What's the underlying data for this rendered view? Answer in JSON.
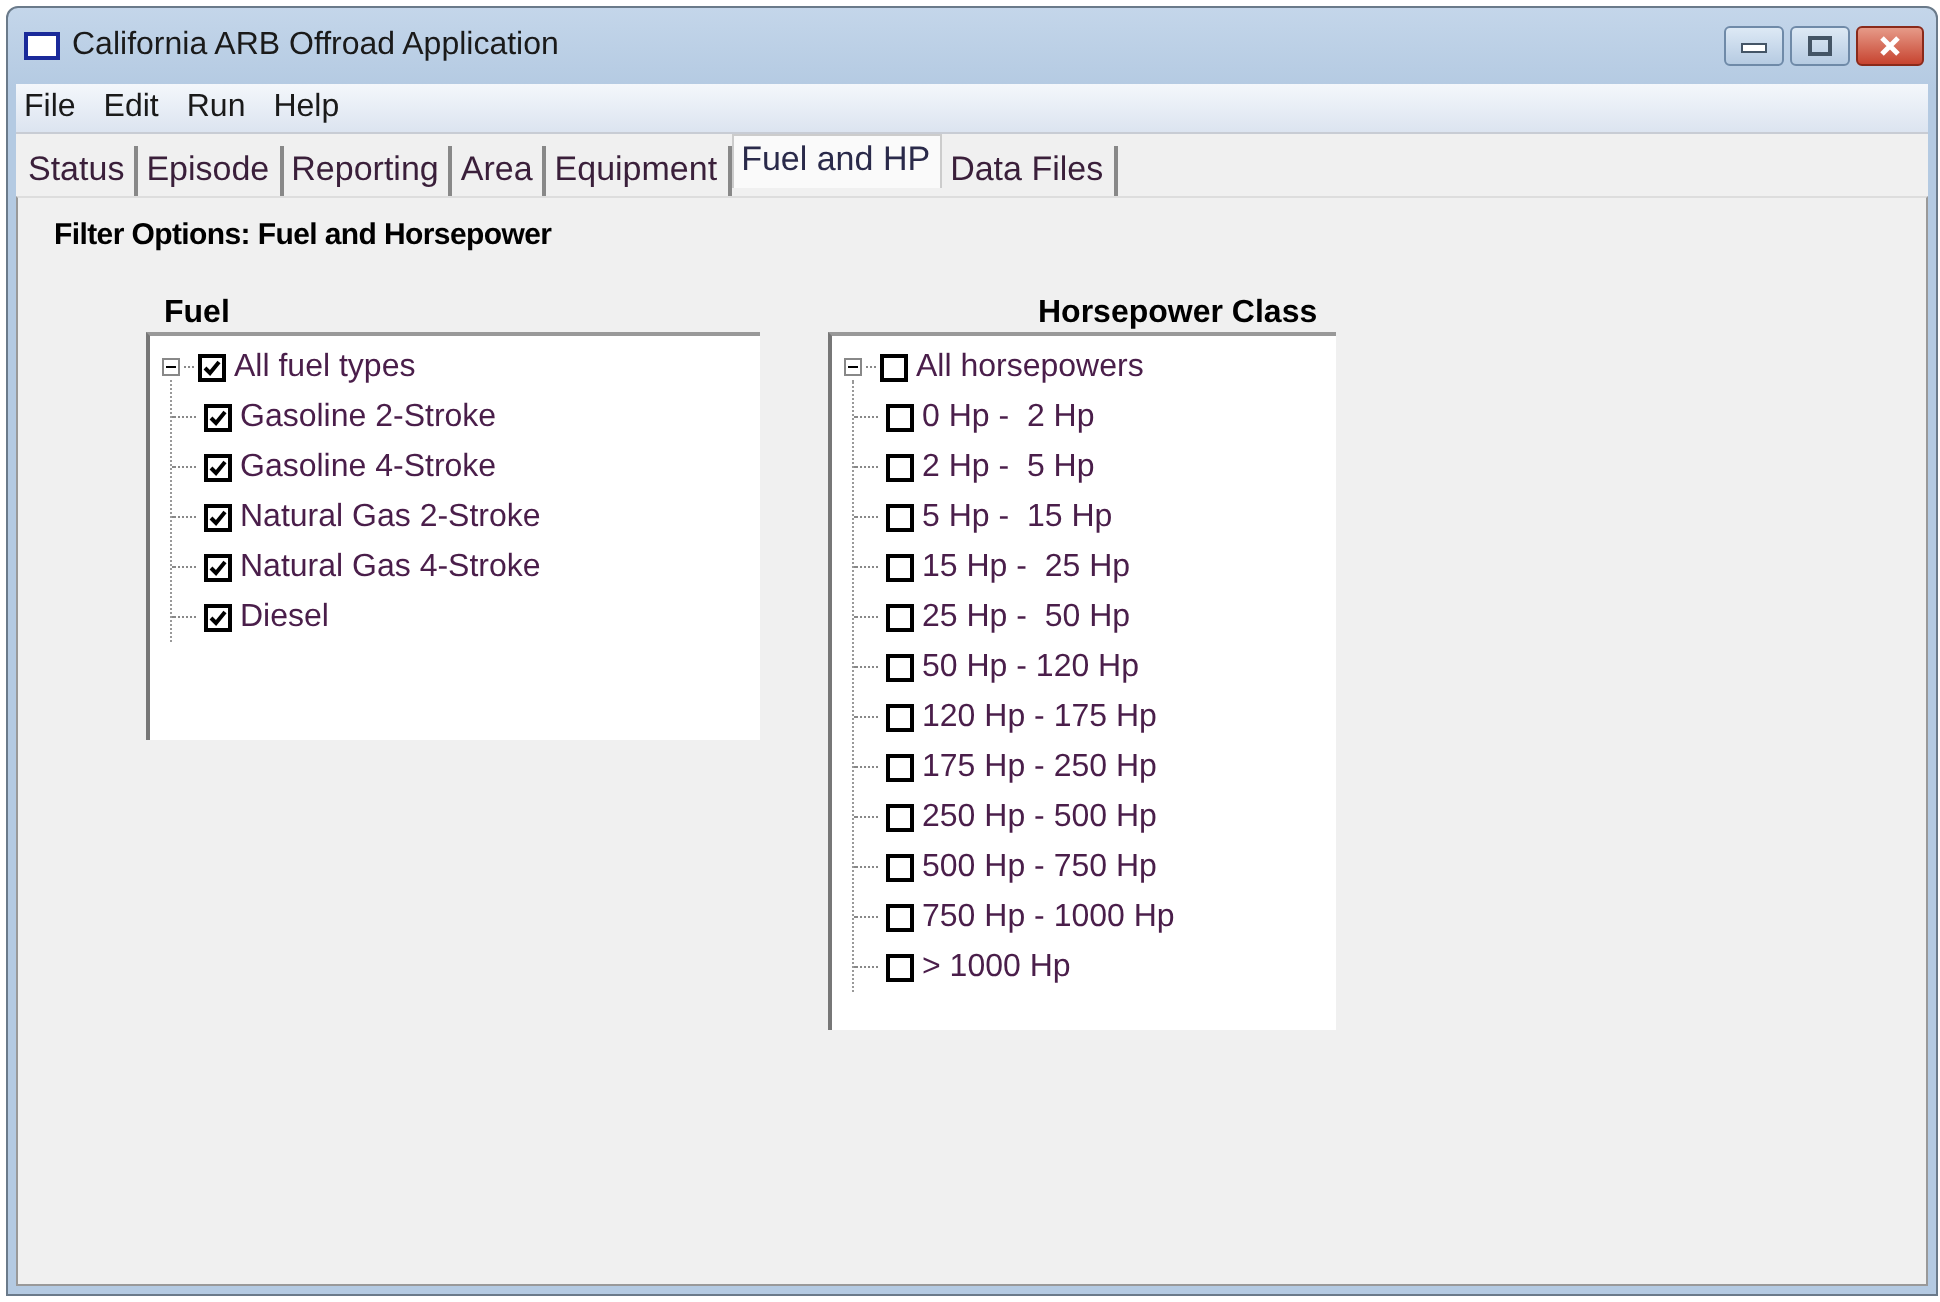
{
  "window": {
    "title": "California ARB Offroad Application"
  },
  "menu": [
    "File",
    "Edit",
    "Run",
    "Help"
  ],
  "tabs": [
    {
      "label": "Status",
      "selected": false
    },
    {
      "label": "Episode",
      "selected": false
    },
    {
      "label": "Reporting",
      "selected": false
    },
    {
      "label": "Area",
      "selected": false
    },
    {
      "label": "Equipment",
      "selected": false
    },
    {
      "label": "Fuel and HP",
      "selected": true
    },
    {
      "label": "Data Files",
      "selected": false
    }
  ],
  "heading": "Filter Options: Fuel and Horsepower",
  "fuel": {
    "title": "Fuel",
    "root": {
      "label": "All fuel types",
      "checked": true,
      "expanded": true,
      "children": [
        {
          "label": "Gasoline 2-Stroke",
          "checked": true
        },
        {
          "label": "Gasoline 4-Stroke",
          "checked": true
        },
        {
          "label": "Natural Gas 2-Stroke",
          "checked": true
        },
        {
          "label": "Natural Gas 4-Stroke",
          "checked": true
        },
        {
          "label": "Diesel",
          "checked": true
        }
      ]
    }
  },
  "horsepower": {
    "title": "Horsepower Class",
    "root": {
      "label": "All horsepowers",
      "checked": false,
      "expanded": true,
      "children": [
        {
          "label": "0 Hp -  2 Hp",
          "checked": false
        },
        {
          "label": "2 Hp -  5 Hp",
          "checked": false
        },
        {
          "label": "5 Hp -  15 Hp",
          "checked": false
        },
        {
          "label": "15 Hp -  25 Hp",
          "checked": false
        },
        {
          "label": "25 Hp -  50 Hp",
          "checked": false
        },
        {
          "label": "50 Hp - 120 Hp",
          "checked": false
        },
        {
          "label": "120 Hp - 175 Hp",
          "checked": false
        },
        {
          "label": "175 Hp - 250 Hp",
          "checked": false
        },
        {
          "label": "250 Hp - 500 Hp",
          "checked": false
        },
        {
          "label": "500 Hp - 750 Hp",
          "checked": false
        },
        {
          "label": "750 Hp - 1000 Hp",
          "checked": false
        },
        {
          "label": "> 1000 Hp",
          "checked": false
        }
      ]
    }
  }
}
